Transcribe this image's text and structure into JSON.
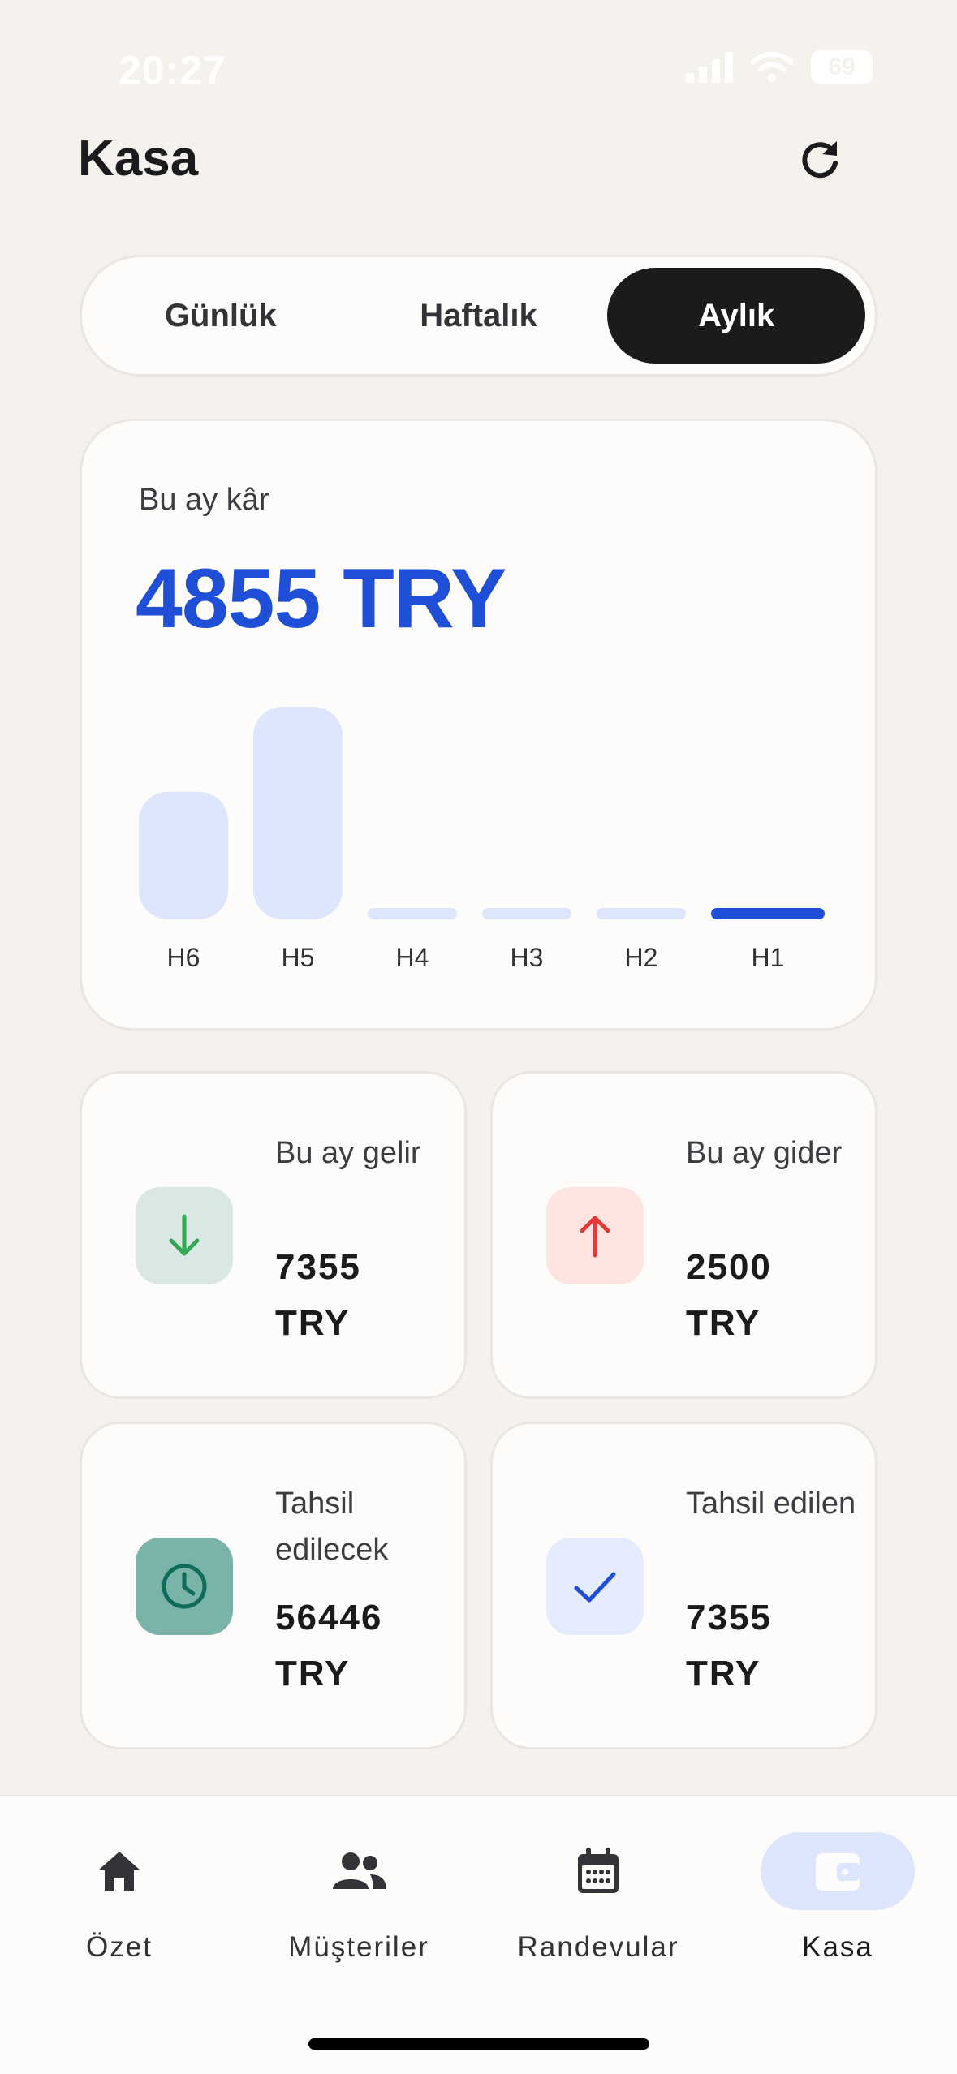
{
  "status_bar": {
    "time": "20:27",
    "battery": "69"
  },
  "header": {
    "title": "Kasa",
    "refresh_icon": "refresh-icon"
  },
  "period_tabs": [
    {
      "label": "Günlük",
      "active": false
    },
    {
      "label": "Haftalık",
      "active": false
    },
    {
      "label": "Aylık",
      "active": true
    }
  ],
  "profit": {
    "label": "Bu ay kâr",
    "value": "4855 TRY",
    "chart_data": {
      "type": "bar",
      "categories": [
        "H6",
        "H5",
        "H4",
        "H3",
        "H2",
        "H1"
      ],
      "values": [
        0.6,
        1.0,
        0.05,
        0.05,
        0.05,
        0.05
      ],
      "highlighted": "H1",
      "colors": {
        "bar": "#dde6fd",
        "highlight": "#1f4fd6"
      }
    }
  },
  "stats": [
    {
      "label": "Bu ay gelir",
      "value": "7355 TRY",
      "icon": "arrow-down-icon",
      "icon_bg": "#d9e8e4",
      "icon_color": "#34a853"
    },
    {
      "label": "Bu ay gider",
      "value": "2500 TRY",
      "icon": "arrow-up-icon",
      "icon_bg": "#fde4e0",
      "icon_color": "#e53935"
    },
    {
      "label": "Tahsil edilecek",
      "value": "56446 TRY",
      "icon": "clock-icon",
      "icon_bg": "#7ab4a8",
      "icon_color": "#0f6b5c"
    },
    {
      "label": "Tahsil edilen",
      "value": "7355 TRY",
      "icon": "check-icon",
      "icon_bg": "#e3ebfd",
      "icon_color": "#1f4fd6"
    }
  ],
  "bottom_nav": [
    {
      "label": "Özet",
      "icon": "home-icon",
      "active": false
    },
    {
      "label": "Müşteriler",
      "icon": "people-icon",
      "active": false
    },
    {
      "label": "Randevular",
      "icon": "calendar-icon",
      "active": false
    },
    {
      "label": "Kasa",
      "icon": "wallet-icon",
      "active": true
    }
  ],
  "colors": {
    "accent": "#1f4fd6",
    "background": "#f5f1ed",
    "card": "#fdfcfb",
    "active_tab": "#1b1b1d"
  }
}
